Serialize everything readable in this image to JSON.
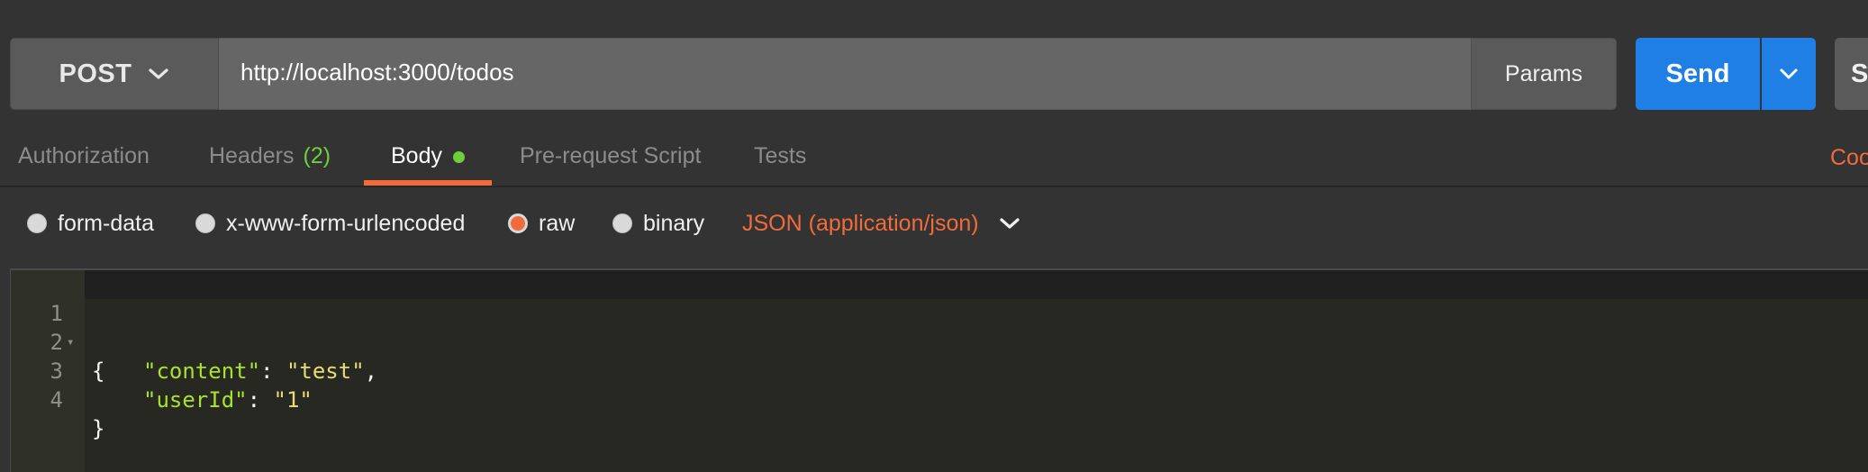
{
  "request": {
    "method": "POST",
    "url": "http://localhost:3000/todos",
    "params_label": "Params",
    "send_label": "Send",
    "save_label": "Sa"
  },
  "tabs": [
    {
      "label": "Authorization",
      "active": false
    },
    {
      "label": "Headers",
      "count": "(2)",
      "active": false
    },
    {
      "label": "Body",
      "active": true
    },
    {
      "label": "Pre-request Script",
      "active": false
    },
    {
      "label": "Tests",
      "active": false
    }
  ],
  "cookies_label": "Coo",
  "body_types": [
    {
      "label": "form-data",
      "checked": false
    },
    {
      "label": "x-www-form-urlencoded",
      "checked": false
    },
    {
      "label": "raw",
      "checked": true
    },
    {
      "label": "binary",
      "checked": false
    }
  ],
  "content_type": "JSON (application/json)",
  "editor": {
    "line_numbers": [
      "1",
      "2",
      "3",
      "4"
    ],
    "lines": {
      "l1_brace": "{",
      "l2_key": "\"content\"",
      "l2_sep": ": ",
      "l2_val": "\"test\"",
      "l2_end": ",",
      "l3_key": "\"userId\"",
      "l3_sep": ": ",
      "l3_val": "\"1\"",
      "l4_brace": "}"
    }
  },
  "colors": {
    "accent_orange": "#f26b3a",
    "send_blue": "#1f7fe5",
    "indicator_green": "#6fcf3a"
  },
  "icons": {
    "method_dropdown": "chevron-down-icon",
    "send_dropdown": "chevron-down-icon",
    "content_type_dropdown": "chevron-down-icon",
    "fold": "fold-arrow-icon"
  }
}
